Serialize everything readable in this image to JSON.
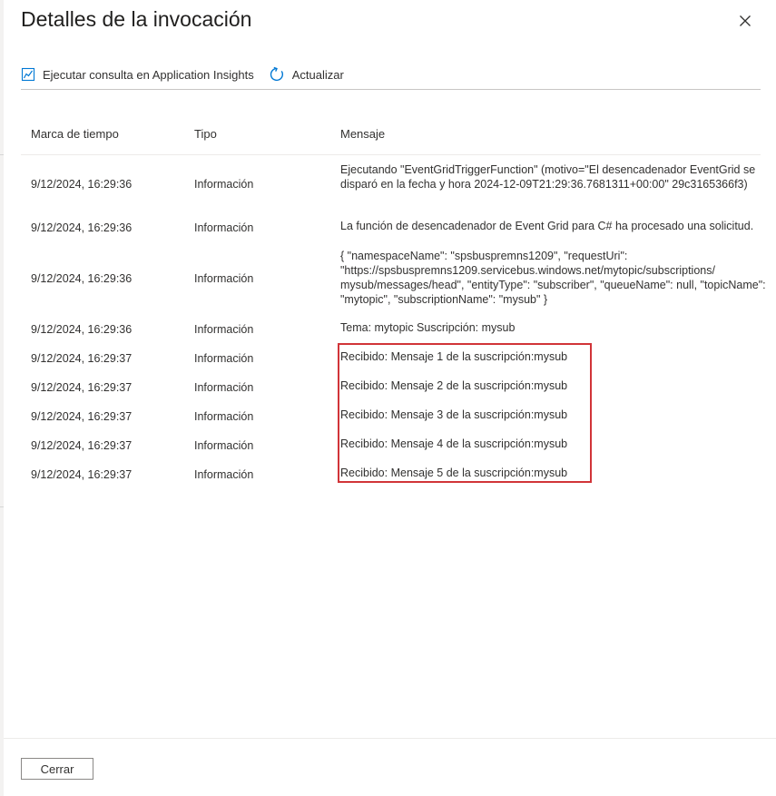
{
  "dialog": {
    "title": "Detalles de la invocación",
    "close_label": "Cerrar"
  },
  "toolbar": {
    "run_query_label": "Ejecutar consulta en Application Insights",
    "refresh_label": "Actualizar"
  },
  "grid": {
    "columns": [
      "Marca de tiempo",
      "Tipo",
      "Mensaje"
    ],
    "rows": [
      {
        "timestamp": "9/12/2024, 16:29:36",
        "type": "Información",
        "message": "Ejecutando \"EventGridTriggerFunction\" (motivo=\"El desencadenador EventGrid se disparó en la fecha y hora 2024-12-09T21:29:36.7681311+00:00\" 29c3165366f3)"
      },
      {
        "timestamp": "9/12/2024, 16:29:36",
        "type": "Información",
        "message": "La función de desencadenador de Event Grid para C# ha procesado una solicitud."
      },
      {
        "timestamp": "9/12/2024, 16:29:36",
        "type": "Información",
        "message": "{ \"namespaceName\": \"spsbuspremns1209\", \"requestUri\": \"https://spsbuspremns1209.servicebus.windows.net/mytopic/subscriptions/ mysub/messages/head\", \"entityType\": \"subscriber\", \"queueName\": null, \"topicName\": \"mytopic\", \"subscriptionName\": \"mysub\" }"
      },
      {
        "timestamp": "9/12/2024, 16:29:36",
        "type": "Información",
        "message": "Tema: mytopic Suscripción: mysub"
      },
      {
        "timestamp": "9/12/2024, 16:29:37",
        "type": "Información",
        "message": "Recibido: Mensaje 1 de la suscripción:mysub"
      },
      {
        "timestamp": "9/12/2024, 16:29:37",
        "type": "Información",
        "message": "Recibido: Mensaje 2 de la suscripción:mysub"
      },
      {
        "timestamp": "9/12/2024, 16:29:37",
        "type": "Información",
        "message": "Recibido: Mensaje 3 de la suscripción:mysub"
      },
      {
        "timestamp": "9/12/2024, 16:29:37",
        "type": "Información",
        "message": "Recibido: Mensaje 4 de la suscripción:mysub"
      },
      {
        "timestamp": "9/12/2024, 16:29:37",
        "type": "Información",
        "message": "Recibido: Mensaje 5 de la suscripción:mysub"
      }
    ]
  },
  "colors": {
    "accent": "#0078d4",
    "highlight": "#d13438",
    "text": "#323130"
  },
  "icons": {
    "run_query": "chart-icon",
    "refresh": "refresh-icon",
    "close": "close-icon"
  }
}
